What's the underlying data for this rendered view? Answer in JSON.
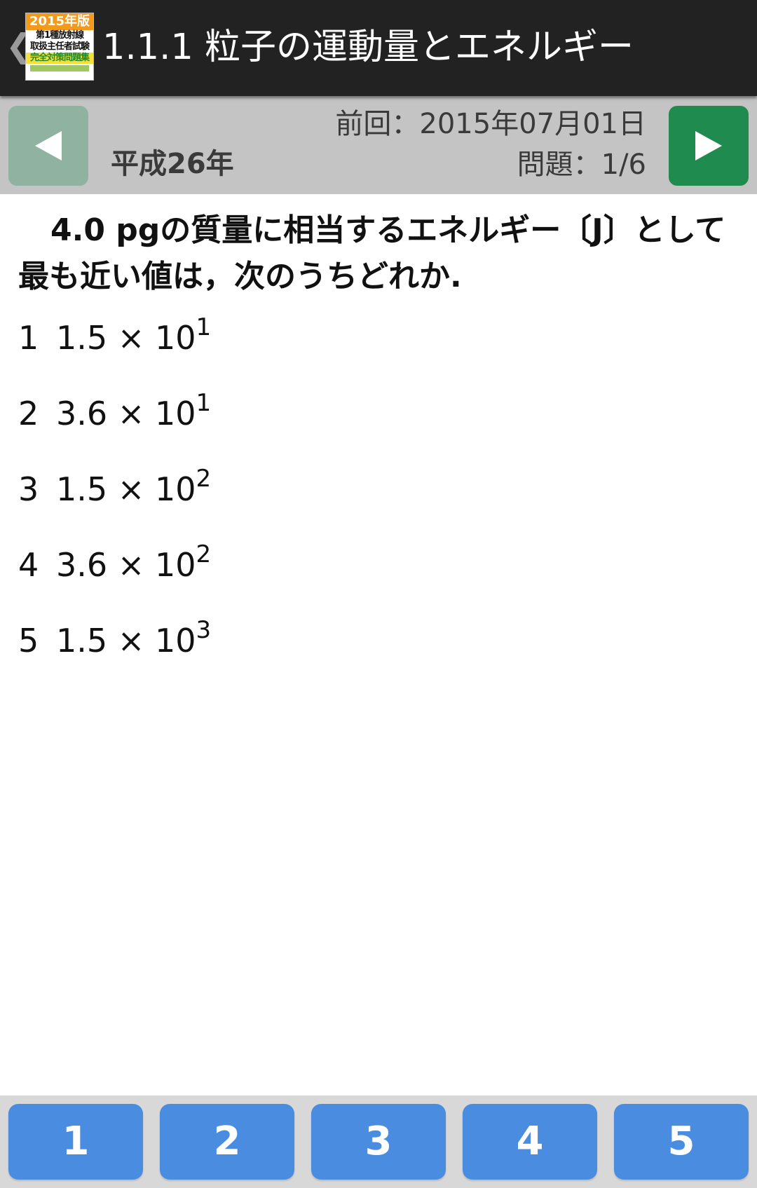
{
  "appbar": {
    "back_glyph": "❮",
    "icon": {
      "year_label": "2015年版",
      "lines": [
        "第1種放射線",
        "取扱主任者試験",
        "完全対策問題集"
      ]
    },
    "title": "1.1.1 粒子の運動量とエネルギー"
  },
  "navbar": {
    "era_label": "平成26年",
    "previous_date": "前回：2015年07月01日",
    "question_count": "問題：1/6",
    "prev_icon": "triangle-left-icon",
    "next_icon": "triangle-right-icon",
    "prev_color": "#8fb3a0",
    "next_color": "#1f8b4f"
  },
  "question": {
    "text": "4.0 pgの質量に相当するエネルギー〔J〕として最も近い値は，次のうちどれか."
  },
  "choices": [
    {
      "number": "1",
      "mantissa": "1.5 × 10",
      "exponent": "1"
    },
    {
      "number": "2",
      "mantissa": "3.6 × 10",
      "exponent": "1"
    },
    {
      "number": "3",
      "mantissa": "1.5 × 10",
      "exponent": "2"
    },
    {
      "number": "4",
      "mantissa": "3.6 × 10",
      "exponent": "2"
    },
    {
      "number": "5",
      "mantissa": "1.5 × 10",
      "exponent": "3"
    }
  ],
  "answer_buttons": [
    "1",
    "2",
    "3",
    "4",
    "5"
  ],
  "colors": {
    "appbar": "#222222",
    "navbar": "#c4c4c4",
    "answer_button": "#4a8de0",
    "answer_bar": "#d8d8d8"
  }
}
